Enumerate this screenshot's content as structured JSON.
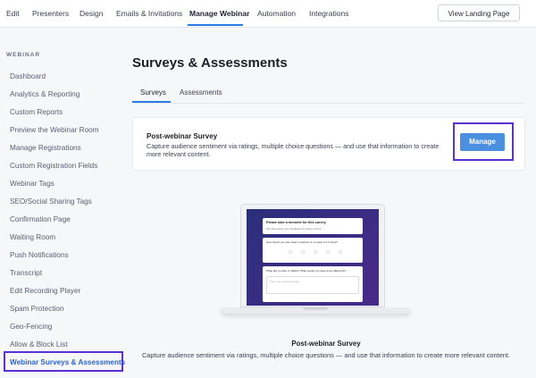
{
  "topnav": {
    "tabs": [
      "Edit",
      "Presenters",
      "Design",
      "Emails & Invitations",
      "Manage Webinar",
      "Automation",
      "Integrations"
    ],
    "active_tab": "Manage Webinar",
    "view_landing_label": "View Landing Page"
  },
  "sidebar": {
    "section_label": "WEBINAR",
    "items": [
      "Dashboard",
      "Analytics & Reporting",
      "Custom Reports",
      "Preview the Webinar Room",
      "Manage Registrations",
      "Custom Registration Fields",
      "Webinar Tags",
      "SEO/Social Sharing Tags",
      "Confirmation Page",
      "Waiting Room",
      "Push Notifications",
      "Transcript",
      "Edit Recording Player",
      "Spam Protection",
      "Geo-Fencing",
      "Allow & Block List",
      "Webinar Surveys & Assessments"
    ],
    "active_item": "Webinar Surveys & Assessments"
  },
  "main": {
    "title": "Surveys & Assessments",
    "tabs": [
      "Surveys",
      "Assessments"
    ],
    "active_tab": "Surveys",
    "card": {
      "title": "Post-webinar Survey",
      "description": "Capture audience sentiment via ratings, multiple choice questions — and use that information to create more relevant content.",
      "manage_label": "Manage"
    },
    "illustration": {
      "screen_heading": "Please take a moment for this survey",
      "screen_subheading": "We appreciate your feedback for future events.",
      "q1": "How would you rate today's webinar on a scale of 1-5 stars?",
      "stars": [
        "☆",
        "☆",
        "☆",
        "☆",
        "☆"
      ],
      "q2": "What did you like or dislike? What would you have done differently?",
      "q2_placeholder": "Type your response here..."
    },
    "caption_title": "Post-webinar Survey",
    "caption_desc": "Capture audience sentiment via ratings, multiple choice questions — and use that information to create more relevant content."
  },
  "colors": {
    "accent": "#2b7be4",
    "button": "#4b8fe0",
    "highlight": "#5b2fd6",
    "screen_gradient": "#2a2f7a"
  }
}
